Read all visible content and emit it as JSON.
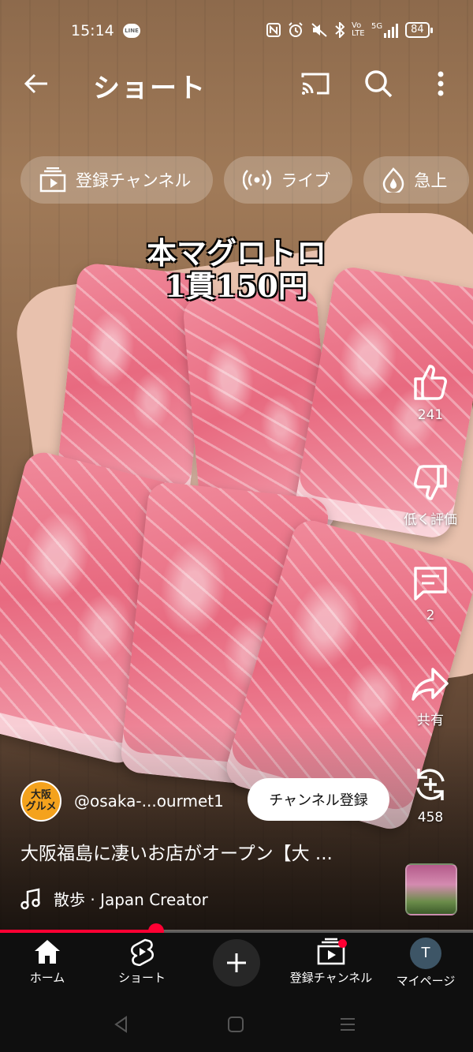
{
  "status_bar": {
    "time": "15:14",
    "line_label": "LINE",
    "battery": "84",
    "network": "5G",
    "volte": "Vo LTE"
  },
  "header": {
    "title": "ショート"
  },
  "chips": [
    {
      "label": "登録チャンネル",
      "icon": "subscriptions-icon"
    },
    {
      "label": "ライブ",
      "icon": "live-icon"
    },
    {
      "label": "急上",
      "icon": "trending-icon"
    }
  ],
  "video": {
    "caption_line1": "本マグロトロ",
    "caption_line2": "1貫150円"
  },
  "actions": {
    "like_count": "241",
    "dislike_label": "低く評価",
    "comment_count": "2",
    "share_label": "共有",
    "remix_count": "458"
  },
  "channel": {
    "avatar_text_1": "大阪",
    "avatar_text_2": "グルメ",
    "handle": "@osaka-...ourmet1",
    "subscribe_label": "チャンネル登録"
  },
  "short": {
    "title": "大阪福島に凄いお店がオープン【大 ...",
    "music": "散歩 · Japan Creator",
    "progress": 0.33
  },
  "bottom_nav": {
    "home": "ホーム",
    "shorts": "ショート",
    "subscriptions": "登録チャンネル",
    "profile": "マイページ",
    "profile_initial": "T"
  },
  "colors": {
    "accent": "#ff0033",
    "nav_bg": "#0f0f0f"
  }
}
